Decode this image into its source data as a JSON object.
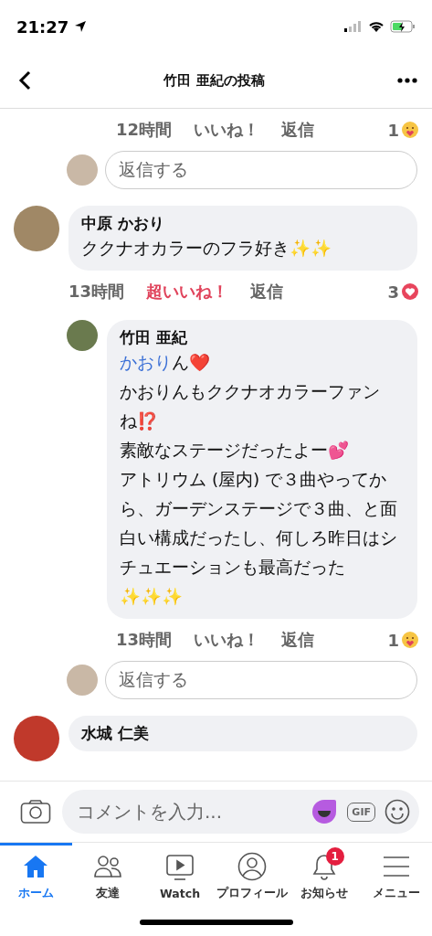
{
  "status_bar": {
    "time": "21:27"
  },
  "header": {
    "title": "竹田 亜紀の投稿"
  },
  "previous_reply": {
    "actions": {
      "time": "12時間",
      "like": "いいね！",
      "liked": false,
      "reply": "返信",
      "reaction_count": "1",
      "kind": "care"
    },
    "reply_box": {
      "placeholder": "返信する"
    }
  },
  "comments": [
    {
      "author": "中原 かおり",
      "paragraphs": [
        {
          "text": "ククナオカラーのフラ好き✨✨"
        }
      ],
      "actions": {
        "time": "13時間",
        "like": "超いいね！",
        "liked": true,
        "reply": "返信",
        "reaction_count": "3",
        "kind": "love"
      },
      "children": [
        {
          "author": "竹田 亜紀",
          "paragraphs": [
            {
              "mention": "かおり",
              "text": "ん❤️"
            },
            {
              "text": "かおりんもククナオカラーファンね⁉️"
            },
            {
              "text": "素敵なステージだったよー💕"
            },
            {
              "text": "アトリウム (屋内) で３曲やってから、ガーデンステージで３曲、と面白い構成だったし、何しろ昨日はシチュエーションも最高だった✨✨✨"
            }
          ],
          "actions": {
            "time": "13時間",
            "like": "いいね！",
            "liked": false,
            "reply": "返信",
            "reaction_count": "1",
            "kind": "care"
          }
        }
      ],
      "reply_box": {
        "placeholder": "返信する"
      }
    },
    {
      "author": "水城 仁美"
    }
  ],
  "composer": {
    "placeholder": "コメントを入力...",
    "gif": "GIF"
  },
  "tabs": [
    {
      "label": "ホーム",
      "selected": true
    },
    {
      "label": "友達",
      "selected": false
    },
    {
      "label": "Watch",
      "selected": false
    },
    {
      "label": "プロフィール",
      "selected": false
    },
    {
      "label": "お知らせ",
      "selected": false,
      "badge": "1"
    },
    {
      "label": "メニュー",
      "selected": false
    }
  ]
}
